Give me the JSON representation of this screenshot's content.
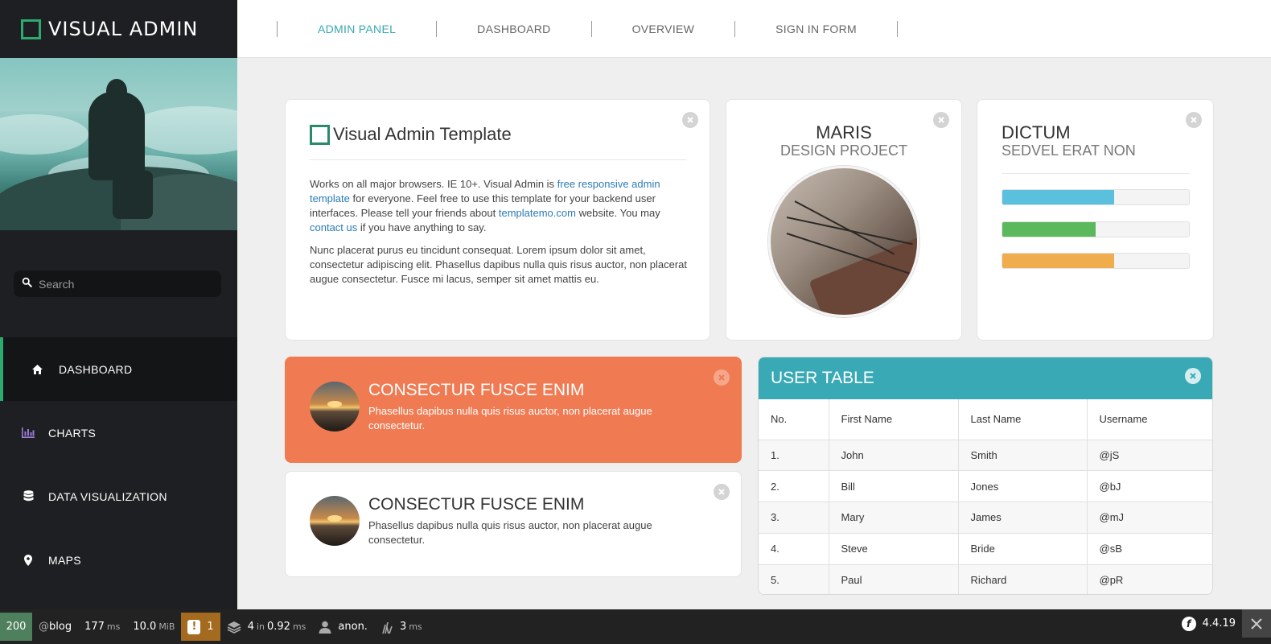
{
  "brand": {
    "title": "VISUAL ADMIN"
  },
  "search": {
    "placeholder": "Search"
  },
  "sidebar": {
    "items": [
      {
        "label": "DASHBOARD",
        "icon": "home-icon",
        "active": true
      },
      {
        "label": "CHARTS",
        "icon": "bar-chart-icon"
      },
      {
        "label": "DATA VISUALIZATION",
        "icon": "database-icon"
      },
      {
        "label": "MAPS",
        "icon": "map-marker-icon"
      }
    ]
  },
  "topnav": {
    "tabs": [
      {
        "label": "ADMIN PANEL",
        "active": true
      },
      {
        "label": "DASHBOARD"
      },
      {
        "label": "OVERVIEW"
      },
      {
        "label": "SIGN IN FORM"
      }
    ]
  },
  "intro": {
    "title": "Visual Admin Template",
    "p1_a": "Works on all major browsers. IE 10+. Visual Admin is ",
    "p1_link1": "free responsive admin template",
    "p1_b": " for everyone. Feel free to use this template for your backend user interfaces. Please tell your friends about ",
    "p1_link2": "templatemo.com",
    "p1_c": " website. You may ",
    "p1_link3": "contact us",
    "p1_d": " if you have anything to say.",
    "p2": "Nunc placerat purus eu tincidunt consequat. Lorem ipsum dolor sit amet, consectetur adipiscing elit. Phasellus dapibus nulla quis risus auctor, non placerat augue consectetur. Fusce mi lacus, semper sit amet mattis eu."
  },
  "profile": {
    "name": "MARIS",
    "subtitle": "DESIGN PROJECT"
  },
  "progress": {
    "title": "DICTUM",
    "subtitle": "SEDVEL ERAT NON",
    "bars": [
      {
        "value": 60,
        "color": "#5bc0de"
      },
      {
        "value": 50,
        "color": "#5cb85c"
      },
      {
        "value": 60,
        "color": "#f0ad4e"
      }
    ]
  },
  "cards": [
    {
      "title": "CONSECTUR FUSCE ENIM",
      "text": "Phasellus dapibus nulla quis risus auctor, non placerat augue consectetur."
    },
    {
      "title": "CONSECTUR FUSCE ENIM",
      "text": "Phasellus dapibus nulla quis risus auctor, non placerat augue consectetur."
    }
  ],
  "user_table": {
    "title": "USER TABLE",
    "headers": [
      "No.",
      "First Name",
      "Last Name",
      "Username"
    ],
    "rows": [
      [
        "1.",
        "John",
        "Smith",
        "@jS"
      ],
      [
        "2.",
        "Bill",
        "Jones",
        "@bJ"
      ],
      [
        "3.",
        "Mary",
        "James",
        "@mJ"
      ],
      [
        "4.",
        "Steve",
        "Bride",
        "@sB"
      ],
      [
        "5.",
        "Paul",
        "Richard",
        "@pR"
      ]
    ]
  },
  "debug_toolbar": {
    "status": "200",
    "route": "blog",
    "time_value": "177",
    "time_unit": "ms",
    "memory": "10.0",
    "memory_unit": "MiB",
    "warnings": "1",
    "queries": "4",
    "queries_in": "in",
    "queries_time": "0.92",
    "queries_unit": "ms",
    "user": "anon.",
    "render_value": "3",
    "render_unit": "ms",
    "version": "4.4.19"
  },
  "colors": {
    "accent_green": "#2bab6f",
    "accent_teal": "#39aab5",
    "card_orange": "#f07a52",
    "sidebar_bg": "#1e1f22"
  }
}
